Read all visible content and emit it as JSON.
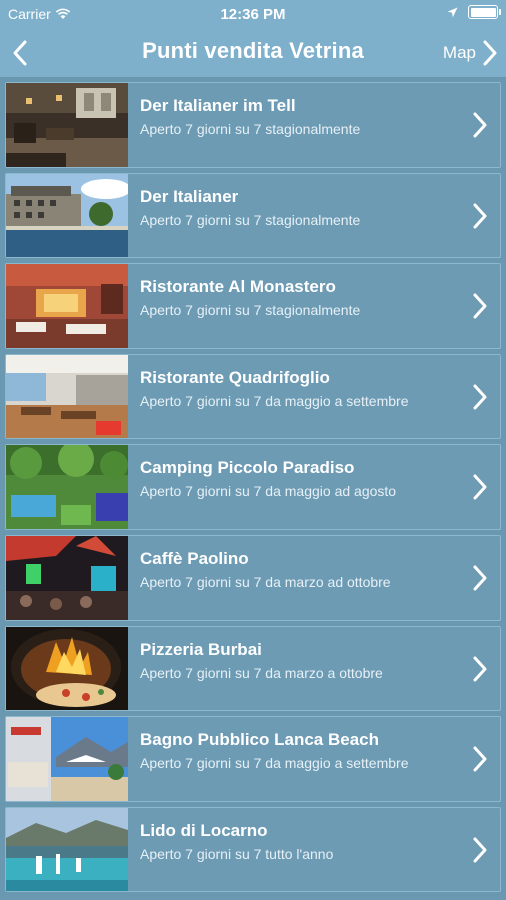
{
  "status": {
    "carrier": "Carrier",
    "time": "12:36 PM"
  },
  "nav": {
    "title": "Punti vendita Vetrina",
    "map_label": "Map"
  },
  "items": [
    {
      "name": "Der Italianer im Tell",
      "hours": "Aperto 7 giorni su 7 stagionalmente"
    },
    {
      "name": "Der Italianer",
      "hours": "Aperto 7 giorni su 7 stagionalmente"
    },
    {
      "name": "Ristorante Al Monastero",
      "hours": "Aperto 7 giorni su 7 stagionalmente"
    },
    {
      "name": "Ristorante Quadrifoglio",
      "hours": "Aperto 7 giorni su 7 da maggio a settembre"
    },
    {
      "name": "Camping Piccolo Paradiso",
      "hours": "Aperto 7 giorni su 7 da maggio ad agosto"
    },
    {
      "name": "Caffè Paolino",
      "hours": "Aperto 7 giorni su 7 da marzo ad ottobre"
    },
    {
      "name": "Pizzeria Burbai",
      "hours": "Aperto 7 giorni su 7 da marzo a ottobre"
    },
    {
      "name": "Bagno Pubblico Lanca Beach",
      "hours": "Aperto 7 giorni su 7 da maggio a settembre"
    },
    {
      "name": "Lido di Locarno",
      "hours": "Aperto 7 giorni su 7 tutto l'anno"
    }
  ],
  "colors": {
    "navbar": "#7eb0cc",
    "background": "#6a98b1",
    "row": "#6d9bb4",
    "text": "#ffffff"
  }
}
